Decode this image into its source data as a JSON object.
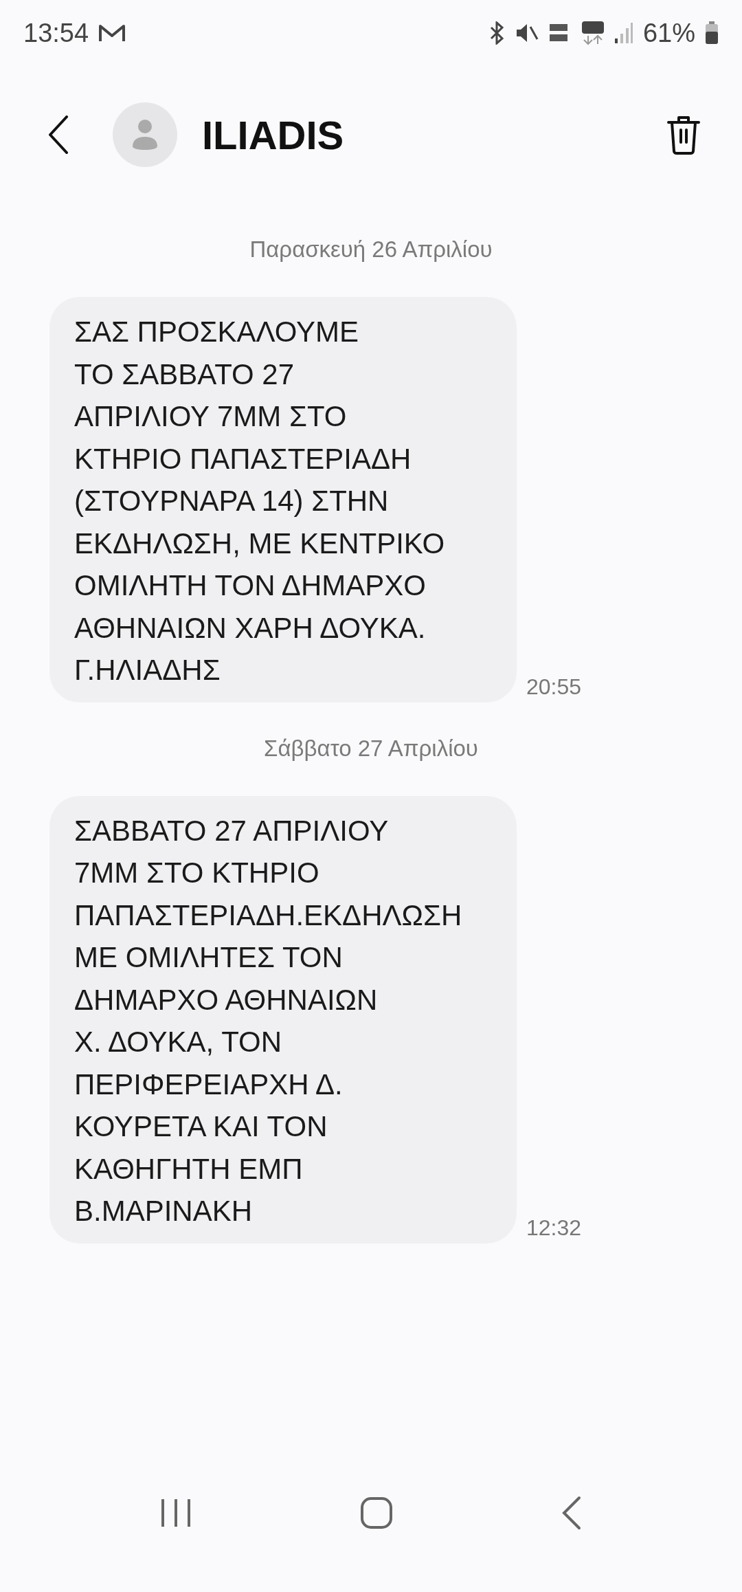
{
  "status_bar": {
    "time": "13:54",
    "battery": "61%"
  },
  "header": {
    "contact": "ILIADIS"
  },
  "messages": [
    {
      "kind": "date",
      "text": "Παρασκευή 26 Απριλίου"
    },
    {
      "kind": "incoming",
      "text": "ΣΑΣ ΠΡΟΣΚΑΛΟΥΜΕ\nΤΟ ΣΑΒΒΑΤΟ 27\nΑΠΡΙΛΙΟΥ 7ΜΜ ΣΤΟ\nΚΤΗΡΙΟ ΠΑΠΑΣΤΕΡΙΑΔΗ\n(ΣΤΟΥΡΝΑΡΑ 14) ΣΤΗΝ\nΕΚΔΗΛΩΣΗ, ΜΕ ΚΕΝΤΡΙΚΟ\nΟΜΙΛΗΤΗ ΤΟΝ ΔΗΜΑΡΧΟ\nΑΘΗΝΑΙΩΝ ΧΑΡΗ ΔΟΥΚΑ.\nΓ.ΗΛΙΑΔΗΣ",
      "time": "20:55"
    },
    {
      "kind": "date",
      "text": "Σάββατο 27 Απριλίου"
    },
    {
      "kind": "incoming",
      "text": "ΣΑΒΒΑΤΟ 27 ΑΠΡΙΛΙΟΥ\n7ΜΜ ΣΤΟ ΚΤΗΡΙΟ\nΠΑΠΑΣΤΕΡΙΑΔΗ.ΕΚΔΗΛΩΣΗ\nΜΕ ΟΜΙΛΗΤΕΣ ΤΟΝ\nΔΗΜΑΡΧΟ ΑΘΗΝΑΙΩΝ\nΧ. ΔΟΥΚΑ, ΤΟΝ\nΠΕΡΙΦΕΡΕΙΑΡΧΗ Δ.\nΚΟΥΡΕΤΑ ΚΑΙ ΤΟΝ\nΚΑΘΗΓΗΤΗ ΕΜΠ\nΒ.ΜΑΡΙΝΑΚΗ",
      "time": "12:32"
    }
  ]
}
